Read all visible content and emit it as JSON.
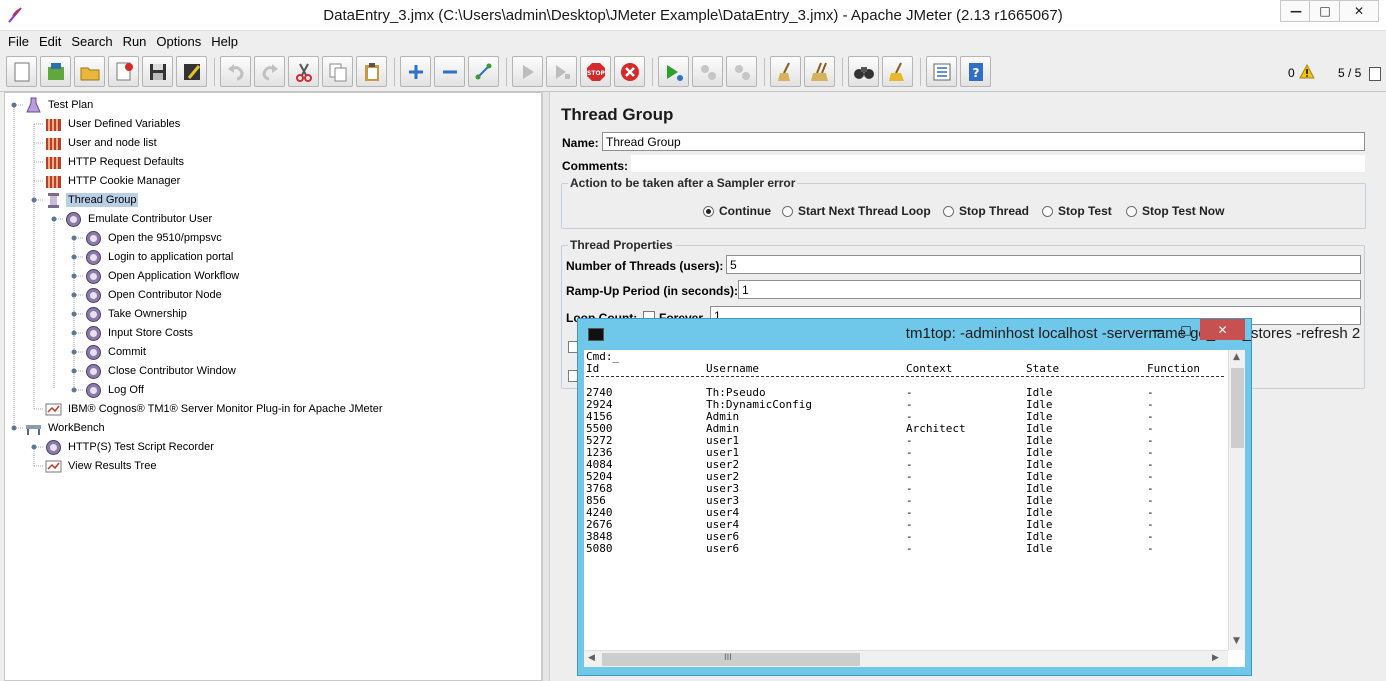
{
  "window": {
    "title": "DataEntry_3.jmx (C:\\Users\\admin\\Desktop\\JMeter Example\\DataEntry_3.jmx) - Apache JMeter (2.13 r1665067)",
    "minimize": "—",
    "maximize": "□",
    "close": "✕"
  },
  "menu": [
    "File",
    "Edit",
    "Search",
    "Run",
    "Options",
    "Help"
  ],
  "toolbar": {
    "buttons": [
      "new",
      "templates",
      "open",
      "close",
      "save",
      "save-as",
      "undo",
      "redo",
      "cut",
      "copy",
      "paste",
      "expand",
      "collapse",
      "toggle",
      "start",
      "start-no-pauses",
      "stop",
      "shutdown",
      "remote-start-all",
      "remote-stop-all",
      "remote-shutdown-all",
      "clear",
      "clear-all",
      "search",
      "reset-search",
      "function-helper",
      "help"
    ],
    "error_count": "0",
    "thread_count": "5 / 5"
  },
  "tree": {
    "nodes": [
      {
        "label": "Test Plan",
        "icon": "flask-icon",
        "depth": 0
      },
      {
        "label": "User Defined Variables",
        "icon": "config-icon",
        "depth": 1
      },
      {
        "label": "User and node list",
        "icon": "config-icon",
        "depth": 1
      },
      {
        "label": "HTTP Request Defaults",
        "icon": "config-icon",
        "depth": 1
      },
      {
        "label": "HTTP Cookie Manager",
        "icon": "config-icon",
        "depth": 1
      },
      {
        "label": "Thread Group",
        "icon": "spool-icon",
        "depth": 1,
        "selected": true
      },
      {
        "label": "Emulate Contributor User",
        "icon": "controller-icon",
        "depth": 2
      },
      {
        "label": "Open the 9510/pmpsvc",
        "icon": "controller-icon",
        "depth": 3
      },
      {
        "label": "Login to application portal",
        "icon": "controller-icon",
        "depth": 3
      },
      {
        "label": "Open Application Workflow",
        "icon": "controller-icon",
        "depth": 3
      },
      {
        "label": "Open Contributor Node",
        "icon": "controller-icon",
        "depth": 3
      },
      {
        "label": "Take Ownership",
        "icon": "controller-icon",
        "depth": 3
      },
      {
        "label": "Input Store Costs",
        "icon": "controller-icon",
        "depth": 3
      },
      {
        "label": "Commit",
        "icon": "controller-icon",
        "depth": 3
      },
      {
        "label": "Close Contributor Window",
        "icon": "controller-icon",
        "depth": 3
      },
      {
        "label": "Log Off",
        "icon": "controller-icon",
        "depth": 3
      },
      {
        "label": "IBM® Cognos® TM1® Server Monitor Plug-in for Apache JMeter",
        "icon": "monitor-icon",
        "depth": 1
      },
      {
        "label": "WorkBench",
        "icon": "workbench-icon",
        "depth": 0
      },
      {
        "label": "HTTP(S) Test Script Recorder",
        "icon": "controller-icon",
        "depth": 1
      },
      {
        "label": "View Results Tree",
        "icon": "monitor-icon",
        "depth": 1
      }
    ]
  },
  "thread_group": {
    "title": "Thread Group",
    "name_label": "Name:",
    "name_value": "Thread Group",
    "comments_label": "Comments:",
    "error_action": {
      "title": "Action to be taken after a Sampler error",
      "options": [
        "Continue",
        "Start Next Thread Loop",
        "Stop Thread",
        "Stop Test",
        "Stop Test Now"
      ],
      "selected": "Continue"
    },
    "properties": {
      "title": "Thread Properties",
      "threads_label": "Number of Threads (users):",
      "threads_value": "5",
      "rampup_label": "Ramp-Up Period (in seconds):",
      "rampup_value": "1",
      "loop_label": "Loop Count:",
      "forever_label": "Forever",
      "loop_value": "1"
    }
  },
  "console": {
    "title": "tm1top: -adminhost localhost -servername go_new_stores -refresh 2",
    "cmd": "Cmd:_",
    "headers": [
      "Id",
      "Username",
      "Context",
      "State",
      "Function"
    ],
    "rows": [
      [
        "2740",
        "Th:Pseudo",
        "-",
        "Idle",
        "-"
      ],
      [
        "2924",
        "Th:DynamicConfig",
        "-",
        "Idle",
        "-"
      ],
      [
        "4156",
        "Admin",
        "-",
        "Idle",
        "-"
      ],
      [
        "5500",
        "Admin",
        "Architect",
        "Idle",
        "-"
      ],
      [
        "5272",
        "user1",
        "-",
        "Idle",
        "-"
      ],
      [
        "1236",
        "user1",
        "-",
        "Idle",
        "-"
      ],
      [
        "4084",
        "user2",
        "-",
        "Idle",
        "-"
      ],
      [
        "5204",
        "user2",
        "-",
        "Idle",
        "-"
      ],
      [
        "3768",
        "user3",
        "-",
        "Idle",
        "-"
      ],
      [
        "856",
        "user3",
        "-",
        "Idle",
        "-"
      ],
      [
        "4240",
        "user4",
        "-",
        "Idle",
        "-"
      ],
      [
        "2676",
        "user4",
        "-",
        "Idle",
        "-"
      ],
      [
        "3848",
        "user6",
        "-",
        "Idle",
        "-"
      ],
      [
        "5080",
        "user6",
        "-",
        "Idle",
        "-"
      ]
    ],
    "scroll_grip": "III"
  }
}
